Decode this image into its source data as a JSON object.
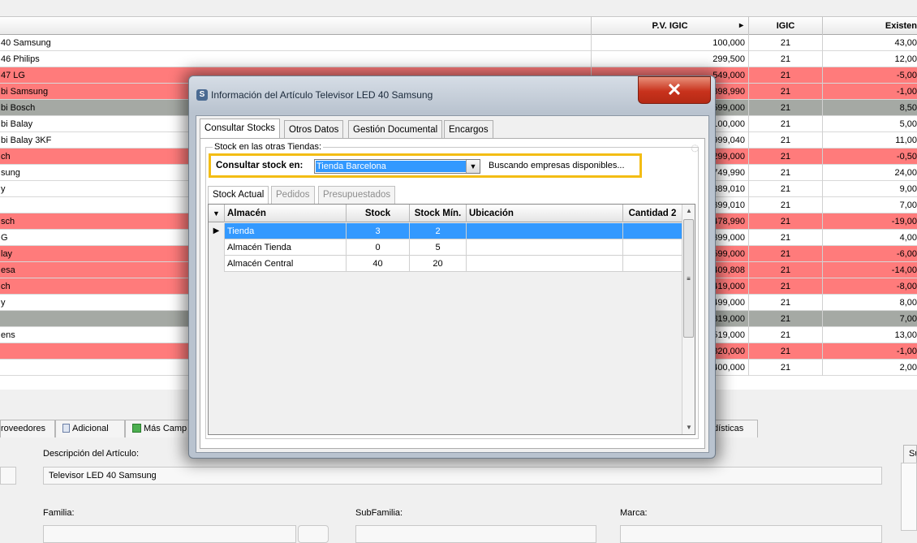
{
  "background_grid": {
    "columns": {
      "pv": "P.V. IGIC",
      "igic": "IGIC",
      "existencias": "Existen"
    },
    "rows": [
      {
        "name": "40 Samsung",
        "pv": "100,000",
        "igic": "21",
        "ex": "43,00",
        "style": "white"
      },
      {
        "name": "46 Philips",
        "pv": "299,500",
        "igic": "21",
        "ex": "12,00",
        "style": "white"
      },
      {
        "name": "47 LG",
        "pv": "549,000",
        "igic": "21",
        "ex": "-5,00",
        "style": "red"
      },
      {
        "name": "bi Samsung",
        "pv": "898,990",
        "igic": "21",
        "ex": "-1,00",
        "style": "red"
      },
      {
        "name": "bi Bosch",
        "pv": "599,000",
        "igic": "21",
        "ex": "8,50",
        "style": "gray"
      },
      {
        "name": "bi Balay",
        "pv": "100,000",
        "igic": "21",
        "ex": "5,00",
        "style": "white"
      },
      {
        "name": "bi Balay 3KF",
        "pv": "999,040",
        "igic": "21",
        "ex": "11,00",
        "style": "white"
      },
      {
        "name": "ch",
        "pv": "299,000",
        "igic": "21",
        "ex": "-0,50",
        "style": "red"
      },
      {
        "name": "sung",
        "pv": "749,990",
        "igic": "21",
        "ex": "24,00",
        "style": "white"
      },
      {
        "name": "y",
        "pv": "389,010",
        "igic": "21",
        "ex": "9,00",
        "style": "white"
      },
      {
        "name": "",
        "pv": "399,010",
        "igic": "21",
        "ex": "7,00",
        "style": "white"
      },
      {
        "name": "sch",
        "pv": "478,990",
        "igic": "21",
        "ex": "-19,00",
        "style": "red"
      },
      {
        "name": "G",
        "pv": "399,000",
        "igic": "21",
        "ex": "4,00",
        "style": "white"
      },
      {
        "name": "lay",
        "pv": "599,000",
        "igic": "21",
        "ex": "-6,00",
        "style": "red"
      },
      {
        "name": "esa",
        "pv": "409,808",
        "igic": "21",
        "ex": "-14,00",
        "style": "red"
      },
      {
        "name": "ch",
        "pv": "419,000",
        "igic": "21",
        "ex": "-8,00",
        "style": "red"
      },
      {
        "name": "y",
        "pv": "499,000",
        "igic": "21",
        "ex": "8,00",
        "style": "white"
      },
      {
        "name": "",
        "pv": "819,000",
        "igic": "21",
        "ex": "7,00",
        "style": "gray"
      },
      {
        "name": "ens",
        "pv": "519,000",
        "igic": "21",
        "ex": "13,00",
        "style": "white"
      },
      {
        "name": "",
        "pv": "820,000",
        "igic": "21",
        "ex": "-1,00",
        "style": "red"
      },
      {
        "name": "",
        "pv": "400,000",
        "igic": "21",
        "ex": "2,00",
        "style": "white"
      }
    ]
  },
  "bottom": {
    "tabs": [
      "roveedores",
      "Adicional",
      "Más Camp",
      "dísticas",
      "Su"
    ],
    "descripcion_label": "Descripción del Artículo:",
    "descripcion_value": "Televisor LED 40 Samsung",
    "familia_label": "Familia:",
    "subfamilia_label": "SubFamilia:",
    "marca_label": "Marca:"
  },
  "dialog": {
    "title": "Información del Artículo Televisor LED 40 Samsung",
    "close_glyph": "✕",
    "tabs": [
      "Consultar Stocks",
      "Otros Datos",
      "Gestión Documental",
      "Encargos"
    ],
    "group_legend": "Stock en las otras Tiendas:",
    "consultar_label": "Consultar stock en:",
    "store_selected": "Tienda Barcelona",
    "searching_text": "Buscando empresas disponibles...",
    "inner_tabs": [
      "Stock Actual",
      "Pedidos",
      "Presupuestados"
    ],
    "grid": {
      "headers": {
        "almacen": "Almacén",
        "stock": "Stock",
        "stock_min": "Stock Mín.",
        "ubicacion": "Ubicación",
        "cantidad2": "Cantidad 2"
      },
      "rows": [
        {
          "almacen": "Tienda",
          "stock": "3",
          "stock_min": "2",
          "selected": true
        },
        {
          "almacen": "Almacén Tienda",
          "stock": "0",
          "stock_min": "5",
          "selected": false
        },
        {
          "almacen": "Almacén Central",
          "stock": "40",
          "stock_min": "20",
          "selected": false
        }
      ]
    }
  },
  "icons": {
    "app": "S",
    "sort_arrow": "▸",
    "dropdown": "▼",
    "row_pointer": "▶",
    "scroll_up": "▲",
    "scroll_down": "▼",
    "grip": "≡"
  }
}
